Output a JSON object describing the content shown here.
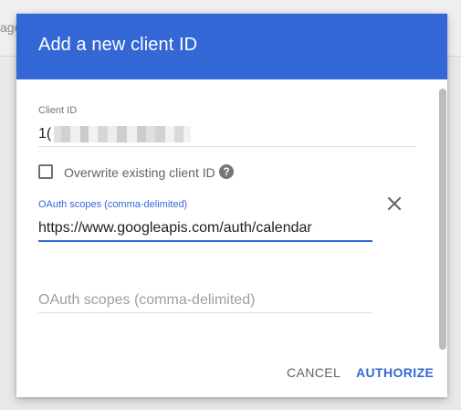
{
  "background": {
    "visible_partial_text": "age"
  },
  "dialog": {
    "title": "Add a new client ID",
    "client_id": {
      "label": "Client ID",
      "value_visible_prefix": "1("
    },
    "overwrite_checkbox": {
      "label": "Overwrite existing client ID",
      "checked": false
    },
    "scopes": [
      {
        "label": "OAuth scopes (comma-delimited)",
        "value": "https://www.googleapis.com/auth/calendar"
      },
      {
        "placeholder": "OAuth scopes (comma-delimited)",
        "value": ""
      }
    ],
    "buttons": {
      "cancel": "CANCEL",
      "authorize": "AUTHORIZE"
    }
  },
  "colors": {
    "header": "#3367d6",
    "accent": "#3367d6",
    "text": "#202124",
    "muted": "#757575",
    "divider": "#e0e0e0"
  },
  "icons": {
    "help": "help-icon",
    "remove": "close-icon"
  }
}
